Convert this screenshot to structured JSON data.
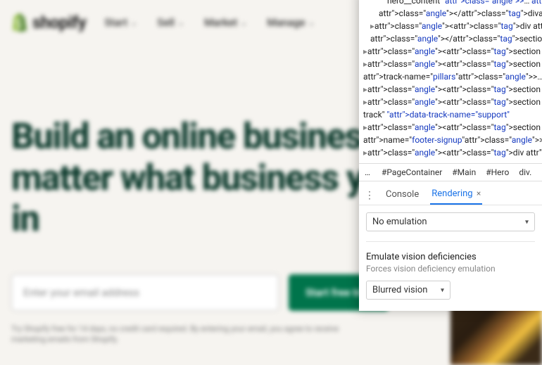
{
  "header": {
    "brand": "shopify",
    "nav": [
      "Start",
      "Sell",
      "Market",
      "Manage"
    ]
  },
  "hero": {
    "headline": "Build an online business—no matter what business you're in",
    "email_placeholder": "Enter your email address",
    "cta": "Start free trial",
    "fineprint": "Try Shopify free for 14 days, no credit card required. By entering your email, you agree to receive marketing emails from Shopify."
  },
  "devtools": {
    "dom_lines": [
      {
        "indent": 3,
        "raw": "hero__content\">…</div>"
      },
      {
        "indent": 2,
        "raw": "</div>"
      },
      {
        "indent": 1,
        "disclose": true,
        "raw": "<div class=\"picture--cover"
      },
      {
        "indent": 1,
        "raw": "</section>"
      },
      {
        "indent": 0,
        "disclose": true,
        "raw": "<section class=\"section background"
      },
      {
        "indent": 0,
        "disclose": true,
        "raw": "<section class=\"section home"
      },
      {
        "indent": 0,
        "raw": "track-name=\"pillars\">…</section>"
      },
      {
        "indent": 0,
        "disclose": true,
        "raw": "<section class=\"section\">…"
      },
      {
        "indent": 0,
        "disclose": true,
        "raw": "<section class=\"section section"
      },
      {
        "indent": 0,
        "raw": "track\" data-track-name=\"support\""
      },
      {
        "indent": 0,
        "disclose": true,
        "raw": "<section class=\"section signup"
      },
      {
        "indent": 0,
        "raw": "name=\"footer-signup\">…</section>"
      },
      {
        "indent": 0,
        "disclose": true,
        "raw": "<div class=\"grid\">…</div>"
      }
    ],
    "breadcrumbs": [
      "#PageContainer",
      "#Main",
      "#Hero",
      "div."
    ],
    "tabs": {
      "console": "Console",
      "rendering": "Rendering"
    },
    "css_media_select": "No emulation",
    "vision": {
      "title": "Emulate vision deficiencies",
      "subtitle": "Forces vision deficiency emulation",
      "select": "Blurred vision"
    }
  }
}
